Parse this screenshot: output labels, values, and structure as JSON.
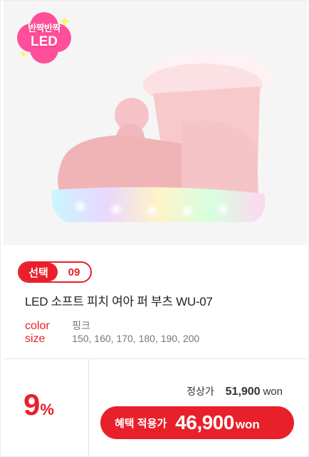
{
  "badge": {
    "line1": "반짝반짝",
    "line2": "LED"
  },
  "product": {
    "select_label": "선택",
    "select_number": "09",
    "name": "LED 소프트 피치 여아 퍼 부츠 WU-07",
    "color_label": "color",
    "color_value": "핑크",
    "size_label": "size",
    "size_value": "150, 160, 170, 180, 190, 200"
  },
  "price": {
    "discount_number": "9",
    "discount_unit": "%",
    "regular_label": "정상가",
    "regular_price": "51,900",
    "regular_unit": "won",
    "sale_label": "혜택 적용가",
    "sale_price": "46,900",
    "sale_unit": "won"
  },
  "colors": {
    "accent": "#e8202a",
    "badge": "#ff4f9a",
    "shoe": "#f6c7c9"
  }
}
